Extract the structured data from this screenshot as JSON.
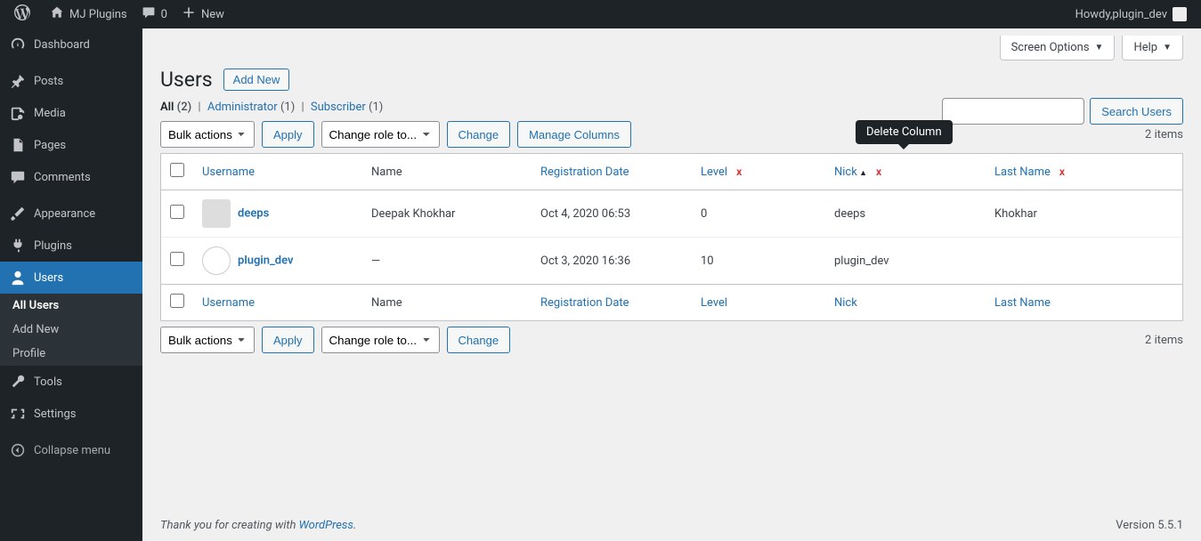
{
  "adminbar": {
    "site": "MJ Plugins",
    "comments": "0",
    "new": "New",
    "howdy_prefix": "Howdy, ",
    "howdy_user": "plugin_dev"
  },
  "sidebar": {
    "dashboard": "Dashboard",
    "posts": "Posts",
    "media": "Media",
    "pages": "Pages",
    "comments": "Comments",
    "appearance": "Appearance",
    "plugins": "Plugins",
    "users": "Users",
    "tools": "Tools",
    "settings": "Settings",
    "collapse": "Collapse menu",
    "users_sub": {
      "all": "All Users",
      "add": "Add New",
      "profile": "Profile"
    }
  },
  "screen_meta": {
    "screen_options": "Screen Options",
    "help": "Help"
  },
  "page": {
    "title": "Users",
    "add_new": "Add New"
  },
  "views": {
    "all": "All",
    "all_count": "(2)",
    "admin": "Administrator",
    "admin_count": "(1)",
    "subscriber": "Subscriber",
    "subscriber_count": "(1)"
  },
  "search": {
    "button": "Search Users"
  },
  "bulk": {
    "bulk_actions": "Bulk actions",
    "apply": "Apply",
    "change_role": "Change role to...",
    "change": "Change",
    "manage_columns": "Manage Columns"
  },
  "count": "2 items",
  "columns": {
    "username": "Username",
    "name": "Name",
    "regdate": "Registration Date",
    "level": "Level",
    "nick": "Nick",
    "lastname": "Last Name"
  },
  "tooltip": "Delete Column",
  "rows": [
    {
      "username": "deeps",
      "name": "Deepak Khokhar",
      "regdate": "Oct 4, 2020 06:53",
      "level": "0",
      "nick": "deeps",
      "lastname": "Khokhar"
    },
    {
      "username": "plugin_dev",
      "name": "—",
      "regdate": "Oct 3, 2020 16:36",
      "level": "10",
      "nick": "plugin_dev",
      "lastname": ""
    }
  ],
  "footer": {
    "thank_prefix": "Thank you for creating with ",
    "wp": "WordPress",
    "period": ".",
    "version": "Version 5.5.1"
  }
}
